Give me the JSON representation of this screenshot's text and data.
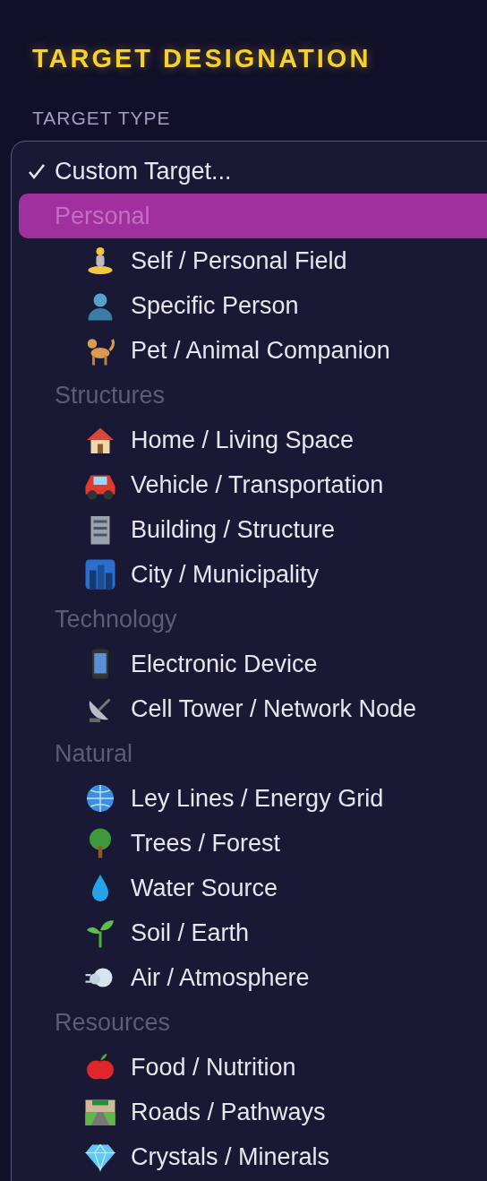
{
  "title": "TARGET DESIGNATION",
  "field_label": "TARGET TYPE",
  "menu": {
    "current": {
      "label": "Custom Target...",
      "checked": true
    },
    "groups": [
      {
        "label": "Personal",
        "highlighted": true,
        "items": [
          "Self / Personal Field",
          "Specific Person",
          "Pet / Animal Companion"
        ]
      },
      {
        "label": "Structures",
        "highlighted": false,
        "items": [
          "Home / Living Space",
          "Vehicle / Transportation",
          "Building / Structure",
          "City / Municipality"
        ]
      },
      {
        "label": "Technology",
        "highlighted": false,
        "items": [
          "Electronic Device",
          "Cell Tower / Network Node"
        ]
      },
      {
        "label": "Natural",
        "highlighted": false,
        "items": [
          "Ley Lines / Energy Grid",
          "Trees / Forest",
          "Water Source",
          "Soil / Earth",
          "Air / Atmosphere"
        ]
      },
      {
        "label": "Resources",
        "highlighted": false,
        "items": [
          "Food / Nutrition",
          "Roads / Pathways",
          "Crystals / Minerals"
        ]
      }
    ]
  }
}
